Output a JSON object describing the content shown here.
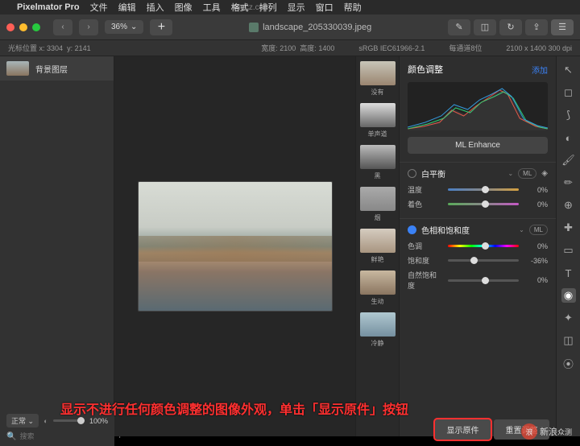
{
  "menubar": {
    "app_name": "Pixelmator Pro",
    "items": [
      "文件",
      "编辑",
      "插入",
      "图像",
      "工具",
      "格式",
      "排列",
      "显示",
      "窗口",
      "帮助"
    ]
  },
  "toolbar": {
    "zoom": "36%",
    "document": "landscape_205330039.jpeg"
  },
  "statusbar": {
    "cursor_label": "光标位置 x:",
    "cursor_x": "3304",
    "cursor_y_label": "y:",
    "cursor_y": "2141",
    "width_label": "宽度:",
    "width": "2100",
    "height_label": "高度:",
    "height": "1400",
    "color_profile": "sRGB IEC61966-2.1",
    "channel": "每通道8位",
    "dimensions": "2100 x 1400 300 dpi"
  },
  "layers": {
    "background": "背景图层",
    "blend_mode": "正常",
    "opacity": "100%",
    "search_placeholder": "搜索"
  },
  "thumbs": {
    "none": "没有",
    "mono": "单声道",
    "black": "黑",
    "smoke": "烟",
    "vivid": "鲜艳",
    "vital": "生动",
    "calm": "冷静"
  },
  "adjustments": {
    "title": "颜色调整",
    "add": "添加",
    "ml_enhance": "ML Enhance",
    "wb": {
      "title": "白平衡",
      "temp_label": "温度",
      "temp_val": "0%",
      "tint_label": "着色",
      "tint_val": "0%",
      "ml": "ML"
    },
    "hsb": {
      "title": "色相和饱和度",
      "hue_label": "色调",
      "hue_val": "0%",
      "sat_label": "饱和度",
      "sat_val": "-36%",
      "vib_label": "自然饱和度",
      "vib_val": "0%",
      "ml": "ML"
    }
  },
  "actions": {
    "show_original": "显示原件",
    "reset": "重置调整"
  },
  "annotation": "显示不进行任何颜色调整的图像外观，单击「显示原件」按钮",
  "watermark": {
    "brand": "新浪",
    "sub": "众测"
  },
  "wm_top": "Macz.com"
}
